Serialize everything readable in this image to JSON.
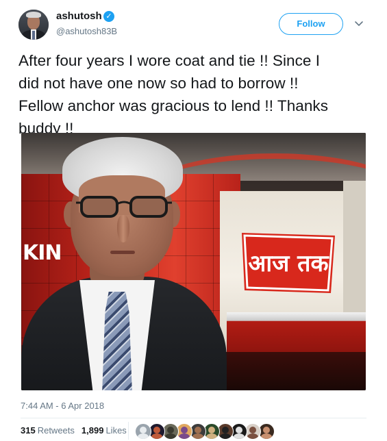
{
  "author": {
    "name": "ashutosh",
    "handle": "@ashutosh83B",
    "verified_glyph": "✓",
    "avatar_icon": "profile-photo"
  },
  "follow_button": {
    "label": "Follow"
  },
  "menu_caret_icon": "chevron-down-icon",
  "tweet": {
    "text": "After four years I wore coat and tie !! Since I\ndid not have one now so had to borrow !!\nFellow anchor was gracious to lend !! Thanks\nbuddy !!"
  },
  "media": {
    "studio_sign_text": "KIN",
    "channel_logo_text": "आज तक"
  },
  "timestamp": "7:44 AM - 6 Apr 2018",
  "stats": {
    "retweets_count": "315",
    "retweets_label": "Retweets",
    "likes_count": "1,899",
    "likes_label": "Likes"
  },
  "colors": {
    "accent": "#1da1f2",
    "text": "#14171a",
    "muted": "#657786",
    "logo_red": "#d8281c"
  },
  "likers": [
    {
      "name": "liker-avatar-1",
      "bg": "#9aa4ad",
      "fg": "#e8ecef"
    },
    {
      "name": "liker-avatar-2",
      "bg": "#1e1a2e",
      "fg": "#c05a3a"
    },
    {
      "name": "liker-avatar-3",
      "bg": "#6a6a5a",
      "fg": "#3a3a30"
    },
    {
      "name": "liker-avatar-4",
      "bg": "#e0a860",
      "fg": "#7a4a8a"
    },
    {
      "name": "liker-avatar-5",
      "bg": "#3c3c3c",
      "fg": "#a07050"
    },
    {
      "name": "liker-avatar-6",
      "bg": "#2a4a2a",
      "fg": "#d0b080"
    },
    {
      "name": "liker-avatar-7",
      "bg": "#5a3a2a",
      "fg": "#202020"
    },
    {
      "name": "liker-avatar-8",
      "bg": "#1a1a1a",
      "fg": "#e0e0e0"
    },
    {
      "name": "liker-avatar-9",
      "bg": "#d8d0c8",
      "fg": "#7a5040"
    },
    {
      "name": "liker-avatar-10",
      "bg": "#3a2a20",
      "fg": "#c89070"
    }
  ]
}
